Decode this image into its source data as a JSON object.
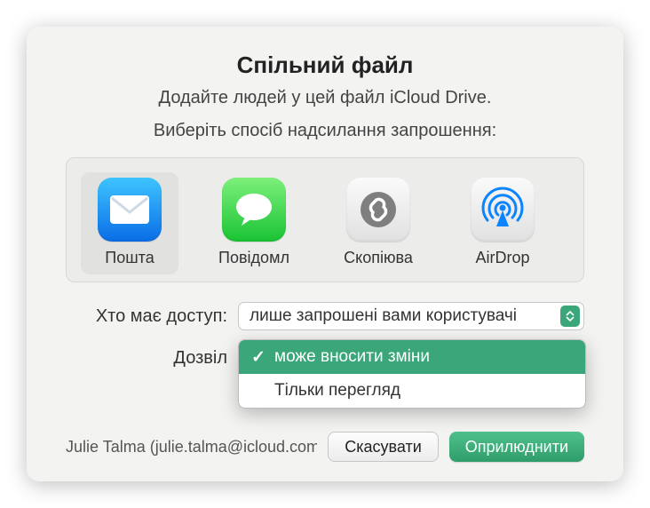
{
  "title": "Спільний файл",
  "subtitle": "Додайте людей у цей файл iCloud Drive.",
  "choose_method": "Виберіть спосіб надсилання запрошення:",
  "methods": {
    "mail": "Пошта",
    "messages": "Повідомл",
    "copylink": "Скопіюва",
    "airdrop": "AirDrop"
  },
  "access": {
    "label": "Хто має доступ:",
    "value": "лише запрошені вами користувачі"
  },
  "permission": {
    "label": "Дозвіл",
    "options": {
      "edit": "може вносити зміни",
      "view": "Тільки перегляд"
    }
  },
  "user": "Julie Talma (julie.talma@icloud.com)",
  "buttons": {
    "cancel": "Скасувати",
    "share": "Оприлюднити"
  }
}
